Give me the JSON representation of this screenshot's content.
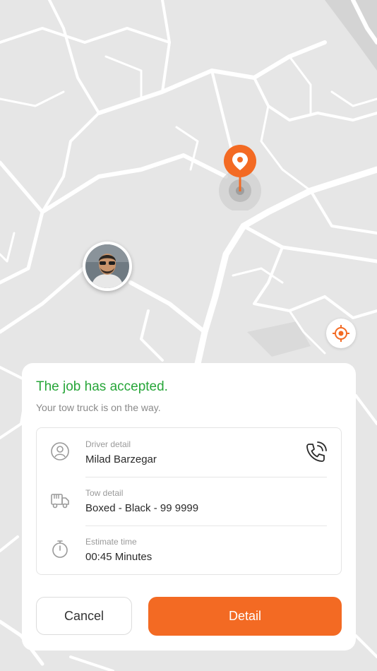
{
  "map": {
    "destination_pin_icon": "location-pin-icon",
    "driver_avatar_icon": "driver-avatar",
    "locate_icon": "crosshair-icon"
  },
  "colors": {
    "accent": "#f36a23",
    "success": "#27a639",
    "map_bg": "#e6e6e6",
    "road": "#ffffff"
  },
  "sheet": {
    "title": "The job has accepted.",
    "subtitle": "Your tow truck is on the way.",
    "rows": [
      {
        "icon": "user-circle-icon",
        "label": "Driver detail",
        "value": "Milad Barzegar",
        "action_icon": "phone-call-icon"
      },
      {
        "icon": "truck-icon",
        "label": "Tow detail",
        "value": "Boxed - Black - 99 9999"
      },
      {
        "icon": "stopwatch-icon",
        "label": "Estimate time",
        "value": "00:45 Minutes"
      }
    ],
    "cancel_label": "Cancel",
    "detail_label": "Detail"
  }
}
